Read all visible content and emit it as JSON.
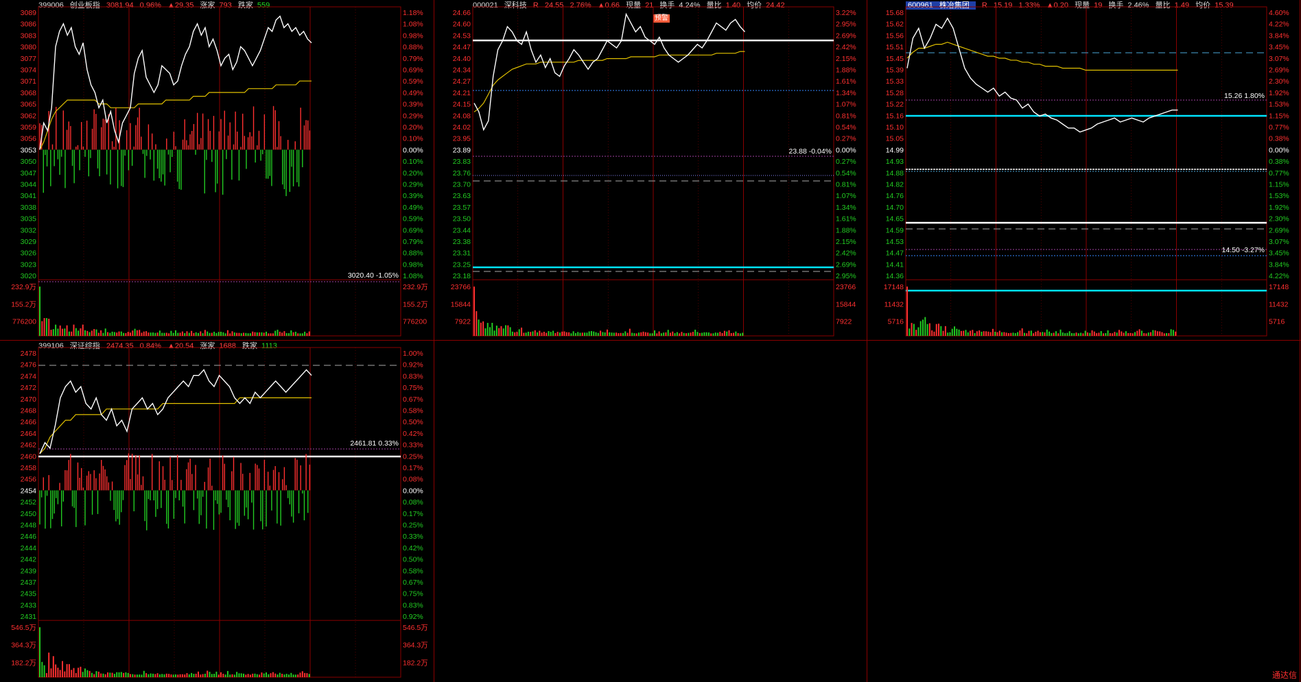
{
  "colors": {
    "up": "#ff3030",
    "down": "#22cc22",
    "price_line": "#ffffff",
    "avg_line": "#e0c000",
    "grid": "#8a0000",
    "background": "#000000"
  },
  "chart_data": [
    {
      "type": "line",
      "panel": "top-left",
      "code": "399006",
      "name": "创业板指",
      "price": "3081.94",
      "pct": "0.96%",
      "chg": "▲29.35",
      "label_a": "涨家",
      "val_a": "793",
      "label_b": "跌家",
      "val_b": "559",
      "base": 3053,
      "left_ticks": [
        "3089",
        "3086",
        "3083",
        "3080",
        "3077",
        "3074",
        "3071",
        "3068",
        "3065",
        "3062",
        "3059",
        "3056",
        "3053",
        "3050",
        "3047",
        "3044",
        "3041",
        "3038",
        "3035",
        "3032",
        "3029",
        "3026",
        "3023",
        "3020"
      ],
      "right_ticks": [
        "1.18%",
        "1.08%",
        "0.98%",
        "0.88%",
        "0.79%",
        "0.69%",
        "0.59%",
        "0.49%",
        "0.39%",
        "0.29%",
        "0.20%",
        "0.10%",
        "0.00%",
        "0.10%",
        "0.20%",
        "0.29%",
        "0.39%",
        "0.49%",
        "0.59%",
        "0.69%",
        "0.79%",
        "0.88%",
        "0.98%",
        "1.08%"
      ],
      "vol_left": [
        "232.9万",
        "155.2万",
        "776200"
      ],
      "vol_right": [
        "232.9万",
        "155.2万",
        "776200"
      ],
      "annotation": "3020.40 -1.05%",
      "price_series": [
        3053,
        3060,
        3058,
        3064,
        3080,
        3084,
        3086,
        3083,
        3085,
        3080,
        3078,
        3081,
        3074,
        3070,
        3068,
        3064,
        3066,
        3060,
        3063,
        3058,
        3055,
        3060,
        3062,
        3064,
        3073,
        3077,
        3079,
        3072,
        3070,
        3068,
        3070,
        3075,
        3074,
        3073,
        3070,
        3071,
        3075,
        3078,
        3080,
        3084,
        3086,
        3083,
        3085,
        3080,
        3082,
        3079,
        3075,
        3077,
        3078,
        3074,
        3076,
        3080,
        3079,
        3077,
        3075,
        3077,
        3079,
        3082,
        3085,
        3084,
        3087,
        3088,
        3085,
        3086,
        3084,
        3085,
        3083,
        3084,
        3082,
        3081
      ],
      "avg_series": [
        3053,
        3055,
        3058,
        3061,
        3063,
        3064,
        3065,
        3066,
        3066,
        3066,
        3066,
        3066,
        3066,
        3066,
        3066,
        3065,
        3065,
        3065,
        3064,
        3064,
        3064,
        3064,
        3064,
        3064,
        3064,
        3065,
        3065,
        3065,
        3065,
        3065,
        3065,
        3065,
        3066,
        3066,
        3066,
        3066,
        3066,
        3066,
        3066,
        3067,
        3067,
        3067,
        3067,
        3068,
        3068,
        3068,
        3068,
        3068,
        3068,
        3068,
        3068,
        3068,
        3068,
        3069,
        3069,
        3069,
        3069,
        3069,
        3069,
        3069,
        3070,
        3070,
        3070,
        3070,
        3070,
        3070,
        3071,
        3071,
        3071,
        3071
      ]
    },
    {
      "type": "line",
      "panel": "top-middle",
      "code": "000021",
      "name": "深科技",
      "flag": "R",
      "price": "24.55",
      "pct": "2.76%",
      "chg": "▲0.66",
      "label_a": "现量",
      "val_a": "21",
      "label_b": "换手",
      "val_b": "4.24%",
      "label_c": "量比",
      "val_c": "1.40",
      "label_d": "均价",
      "val_d": "24.42",
      "badge": "预警",
      "left_ticks": [
        "24.66",
        "24.60",
        "24.53",
        "24.47",
        "24.40",
        "24.34",
        "24.27",
        "24.21",
        "24.15",
        "24.08",
        "24.02",
        "23.95",
        "23.89",
        "23.83",
        "23.76",
        "23.70",
        "23.63",
        "23.57",
        "23.50",
        "23.44",
        "23.38",
        "23.31",
        "23.25",
        "23.18"
      ],
      "right_ticks": [
        "3.22%",
        "2.95%",
        "2.69%",
        "2.42%",
        "2.15%",
        "1.88%",
        "1.61%",
        "1.34%",
        "1.07%",
        "0.81%",
        "0.54%",
        "0.27%",
        "0.00%",
        "0.27%",
        "0.54%",
        "0.81%",
        "1.07%",
        "1.34%",
        "1.61%",
        "1.88%",
        "2.15%",
        "2.42%",
        "2.69%",
        "2.95%"
      ],
      "vol_left": [
        "23766",
        "15844",
        "7922"
      ],
      "vol_right": [
        "23766",
        "15844",
        "7922"
      ],
      "annotation": "23.88 -0.04%",
      "price_series": [
        24.15,
        24.1,
        24.0,
        24.05,
        24.3,
        24.45,
        24.5,
        24.58,
        24.55,
        24.5,
        24.48,
        24.55,
        24.45,
        24.38,
        24.42,
        24.35,
        24.4,
        24.32,
        24.3,
        24.36,
        24.4,
        24.45,
        24.42,
        24.38,
        24.34,
        24.38,
        24.4,
        24.45,
        24.5,
        24.48,
        24.46,
        24.5,
        24.65,
        24.6,
        24.55,
        24.58,
        24.52,
        24.5,
        24.48,
        24.52,
        24.46,
        24.42,
        24.4,
        24.38,
        24.4,
        24.42,
        24.45,
        24.48,
        24.46,
        24.5,
        24.55,
        24.6,
        24.58,
        24.56,
        24.6,
        24.62,
        24.58,
        24.55
      ],
      "avg_series": [
        24.1,
        24.12,
        24.15,
        24.2,
        24.25,
        24.28,
        24.3,
        24.32,
        24.34,
        24.35,
        24.36,
        24.37,
        24.37,
        24.37,
        24.38,
        24.38,
        24.38,
        24.38,
        24.38,
        24.38,
        24.38,
        24.38,
        24.39,
        24.39,
        24.39,
        24.39,
        24.39,
        24.39,
        24.4,
        24.4,
        24.4,
        24.4,
        24.4,
        24.41,
        24.41,
        24.41,
        24.41,
        24.41,
        24.41,
        24.42,
        24.42,
        24.42,
        24.42,
        24.42,
        24.42,
        24.42,
        24.42,
        24.42,
        24.42,
        24.42,
        24.42,
        24.43,
        24.43,
        24.43,
        24.43,
        24.43,
        24.44,
        24.44
      ]
    },
    {
      "type": "line",
      "panel": "top-right",
      "code": "600961",
      "name": "株冶集团",
      "flag": "R",
      "price": "15.19",
      "pct": "1.33%",
      "chg": "▲0.20",
      "label_a": "现量",
      "val_a": "19",
      "label_b": "换手",
      "val_b": "2.46%",
      "label_c": "量比",
      "val_c": "1.49",
      "label_d": "均价",
      "val_d": "15.39",
      "left_ticks": [
        "15.68",
        "15.62",
        "15.56",
        "15.51",
        "15.45",
        "15.39",
        "15.33",
        "15.28",
        "15.22",
        "15.16",
        "15.10",
        "15.05",
        "14.99",
        "14.93",
        "14.88",
        "14.82",
        "14.76",
        "14.70",
        "14.65",
        "14.59",
        "14.53",
        "14.47",
        "14.41",
        "14.36"
      ],
      "right_ticks": [
        "4.60%",
        "4.22%",
        "3.84%",
        "3.45%",
        "3.07%",
        "2.69%",
        "2.30%",
        "1.92%",
        "1.53%",
        "1.15%",
        "0.77%",
        "0.38%",
        "0.00%",
        "0.38%",
        "0.77%",
        "1.15%",
        "1.53%",
        "1.92%",
        "2.30%",
        "2.69%",
        "3.07%",
        "3.45%",
        "3.84%",
        "4.22%"
      ],
      "vol_left": [
        "17148",
        "11432",
        "5716"
      ],
      "vol_right": [
        "17148",
        "11432",
        "5716"
      ],
      "annotation_a": "15.26 1.80%",
      "annotation_b": "14.50 -3.27%",
      "price_series": [
        15.4,
        15.55,
        15.6,
        15.5,
        15.55,
        15.62,
        15.6,
        15.65,
        15.6,
        15.5,
        15.4,
        15.35,
        15.32,
        15.3,
        15.28,
        15.3,
        15.26,
        15.28,
        15.25,
        15.24,
        15.2,
        15.22,
        15.18,
        15.16,
        15.17,
        15.15,
        15.14,
        15.12,
        15.1,
        15.1,
        15.08,
        15.09,
        15.1,
        15.12,
        15.13,
        15.14,
        15.15,
        15.13,
        15.14,
        15.15,
        15.14,
        15.13,
        15.15,
        15.16,
        15.17,
        15.18,
        15.19,
        15.19
      ],
      "avg_series": [
        15.45,
        15.48,
        15.5,
        15.5,
        15.51,
        15.52,
        15.52,
        15.53,
        15.52,
        15.51,
        15.5,
        15.49,
        15.48,
        15.47,
        15.46,
        15.46,
        15.45,
        15.45,
        15.44,
        15.44,
        15.43,
        15.43,
        15.42,
        15.42,
        15.41,
        15.41,
        15.41,
        15.4,
        15.4,
        15.4,
        15.4,
        15.39,
        15.39,
        15.39,
        15.39,
        15.39,
        15.39,
        15.39,
        15.39,
        15.39,
        15.39,
        15.39,
        15.39,
        15.39,
        15.39,
        15.39,
        15.39,
        15.39
      ]
    },
    {
      "type": "line",
      "panel": "bottom-left",
      "code": "399106",
      "name": "深证综指",
      "price": "2474.35",
      "pct": "0.84%",
      "chg": "▲20.54",
      "label_a": "涨家",
      "val_a": "1688",
      "label_b": "跌家",
      "val_b": "1113",
      "left_ticks": [
        "2478",
        "2476",
        "2474",
        "2472",
        "2470",
        "2468",
        "2466",
        "2464",
        "2462",
        "2460",
        "2458",
        "2456",
        "2454",
        "2452",
        "2450",
        "2448",
        "2446",
        "2444",
        "2442",
        "2439",
        "2437",
        "2435",
        "2433",
        "2431"
      ],
      "right_ticks": [
        "1.00%",
        "0.92%",
        "0.83%",
        "0.75%",
        "0.67%",
        "0.58%",
        "0.50%",
        "0.42%",
        "0.33%",
        "0.25%",
        "0.17%",
        "0.08%",
        "0.00%",
        "0.08%",
        "0.17%",
        "0.25%",
        "0.33%",
        "0.42%",
        "0.50%",
        "0.58%",
        "0.67%",
        "0.75%",
        "0.83%",
        "0.92%"
      ],
      "vol_left": [
        "546.5万",
        "364.3万",
        "182.2万"
      ],
      "vol_right": [
        "546.5万",
        "364.3万",
        "182.2万"
      ],
      "annotation": "2461.81 0.33%",
      "price_series": [
        2460,
        2462,
        2461,
        2465,
        2470,
        2472,
        2473,
        2471,
        2472,
        2469,
        2468,
        2470,
        2467,
        2466,
        2468,
        2465,
        2466,
        2464,
        2468,
        2469,
        2470,
        2468,
        2469,
        2467,
        2468,
        2470,
        2471,
        2472,
        2473,
        2472,
        2474,
        2474,
        2475,
        2473,
        2472,
        2474,
        2473,
        2472,
        2470,
        2469,
        2470,
        2469,
        2471,
        2470,
        2471,
        2472,
        2473,
        2472,
        2471,
        2472,
        2473,
        2474,
        2475,
        2474
      ],
      "avg_series": [
        2460,
        2461,
        2463,
        2464,
        2465,
        2466,
        2466,
        2467,
        2467,
        2467,
        2467,
        2467,
        2467,
        2468,
        2468,
        2468,
        2468,
        2468,
        2468,
        2468,
        2468,
        2468,
        2468,
        2468,
        2469,
        2469,
        2469,
        2469,
        2469,
        2469,
        2469,
        2469,
        2469,
        2469,
        2469,
        2469,
        2469,
        2469,
        2469,
        2470,
        2470,
        2470,
        2470,
        2470,
        2470,
        2470,
        2470,
        2470,
        2470,
        2470,
        2470,
        2470,
        2470,
        2470
      ]
    }
  ],
  "logo": "通达信"
}
